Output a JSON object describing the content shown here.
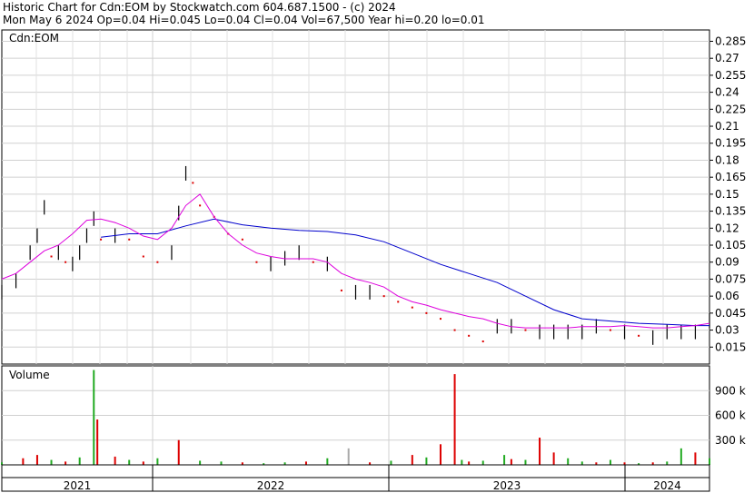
{
  "header": {
    "line1": "Historic Chart for Cdn:EOM by Stockwatch.com 604.687.1500 - (c) 2024",
    "line2": "Mon May  6 2024  Op=0.04  Hi=0.045  Lo=0.04  Cl=0.04  Vol=67,500  Year hi=0.20  lo=0.01"
  },
  "chart_data": [
    {
      "type": "line",
      "title": "Cdn:EOM",
      "xlabel": "",
      "ylabel": "",
      "x_tick_labels": [
        "2021",
        "2022",
        "2023",
        "2024"
      ],
      "y_ticks": [
        0.015,
        0.03,
        0.045,
        0.06,
        0.075,
        0.09,
        0.105,
        0.12,
        0.135,
        0.15,
        0.165,
        0.18,
        0.195,
        0.21,
        0.225,
        0.24,
        0.255,
        0.27,
        0.285
      ],
      "ylim": [
        0.0,
        0.295
      ],
      "xlim": [
        0,
        100
      ],
      "grid": true,
      "colors": {
        "up": "#000000",
        "down": "#dd0000",
        "ma_short": "#dd00dd",
        "ma_long": "#0000cc"
      },
      "series": [
        {
          "name": "",
          "kind": "price",
          "x": [
            0,
            2,
            4,
            5,
            6,
            7,
            8,
            9,
            10,
            11,
            12,
            13,
            14,
            16,
            18,
            20,
            22,
            24,
            25,
            26,
            27,
            28,
            30,
            32,
            34,
            36,
            38,
            40,
            42,
            44,
            46,
            48,
            50,
            52,
            54,
            56,
            58,
            60,
            62,
            64,
            66,
            68,
            70,
            72,
            74,
            76,
            78,
            80,
            82,
            84,
            86,
            88,
            90,
            92,
            94,
            96,
            98,
            100
          ],
          "y": [
            0.065,
            0.075,
            0.1,
            0.115,
            0.14,
            0.095,
            0.1,
            0.09,
            0.09,
            0.1,
            0.115,
            0.13,
            0.11,
            0.115,
            0.11,
            0.095,
            0.09,
            0.1,
            0.135,
            0.17,
            0.16,
            0.14,
            0.13,
            0.115,
            0.11,
            0.09,
            0.09,
            0.095,
            0.1,
            0.09,
            0.09,
            0.065,
            0.065,
            0.065,
            0.06,
            0.055,
            0.05,
            0.045,
            0.04,
            0.03,
            0.025,
            0.02,
            0.035,
            0.035,
            0.03,
            0.03,
            0.03,
            0.03,
            0.03,
            0.035,
            0.03,
            0.03,
            0.025,
            0.025,
            0.03,
            0.03,
            0.03,
            0.04
          ]
        },
        {
          "name": "",
          "kind": "ma_short",
          "x": [
            0,
            2,
            4,
            6,
            8,
            10,
            12,
            14,
            16,
            18,
            20,
            22,
            24,
            26,
            28,
            30,
            32,
            34,
            36,
            38,
            40,
            42,
            44,
            46,
            48,
            50,
            52,
            54,
            56,
            58,
            60,
            62,
            64,
            66,
            68,
            70,
            72,
            74,
            76,
            78,
            80,
            82,
            84,
            86,
            88,
            90,
            92,
            94,
            96,
            98,
            100
          ],
          "y": [
            0.075,
            0.08,
            0.09,
            0.1,
            0.105,
            0.115,
            0.127,
            0.128,
            0.125,
            0.12,
            0.113,
            0.11,
            0.12,
            0.14,
            0.15,
            0.13,
            0.115,
            0.105,
            0.098,
            0.095,
            0.093,
            0.093,
            0.093,
            0.09,
            0.08,
            0.075,
            0.072,
            0.068,
            0.06,
            0.055,
            0.052,
            0.048,
            0.045,
            0.042,
            0.04,
            0.036,
            0.033,
            0.032,
            0.032,
            0.032,
            0.032,
            0.033,
            0.033,
            0.033,
            0.034,
            0.033,
            0.032,
            0.032,
            0.033,
            0.034,
            0.036
          ]
        },
        {
          "name": "",
          "kind": "ma_long",
          "x": [
            14,
            18,
            22,
            26,
            30,
            34,
            38,
            42,
            46,
            50,
            54,
            58,
            62,
            66,
            70,
            74,
            78,
            82,
            86,
            90,
            94,
            98,
            100
          ],
          "y": [
            0.112,
            0.115,
            0.115,
            0.122,
            0.128,
            0.123,
            0.12,
            0.118,
            0.117,
            0.114,
            0.108,
            0.098,
            0.088,
            0.08,
            0.072,
            0.06,
            0.048,
            0.04,
            0.038,
            0.036,
            0.035,
            0.034,
            0.034
          ]
        }
      ]
    },
    {
      "type": "bar",
      "title": "Volume",
      "y_tick_labels": [
        "300 k",
        "600 k",
        "900 k"
      ],
      "y_ticks": [
        300000,
        600000,
        900000
      ],
      "ylim": [
        0,
        1200000
      ],
      "x": [
        0,
        3,
        5,
        7,
        9,
        11,
        13,
        13.5,
        16,
        18,
        20,
        22,
        25,
        28,
        31,
        34,
        37,
        40,
        43,
        46,
        49,
        52,
        55,
        58,
        60,
        62,
        64,
        65,
        66,
        68,
        71,
        72,
        74,
        76,
        78,
        80,
        82,
        84,
        86,
        88,
        90,
        92,
        94,
        96,
        98,
        100
      ],
      "values": [
        30000,
        80000,
        120000,
        60000,
        40000,
        90000,
        1150000,
        550000,
        100000,
        60000,
        40000,
        80000,
        300000,
        50000,
        40000,
        30000,
        20000,
        30000,
        40000,
        80000,
        200000,
        30000,
        50000,
        120000,
        90000,
        250000,
        1100000,
        60000,
        40000,
        50000,
        120000,
        70000,
        60000,
        330000,
        150000,
        80000,
        40000,
        30000,
        60000,
        30000,
        20000,
        30000,
        40000,
        200000,
        150000,
        80000
      ],
      "colors": [
        "#22aa22",
        "#dd0000",
        "#dd0000",
        "#22aa22",
        "#dd0000",
        "#22aa22",
        "#22aa22",
        "#dd0000",
        "#dd0000",
        "#22aa22",
        "#dd0000",
        "#22aa22",
        "#dd0000",
        "#22aa22",
        "#22aa22",
        "#dd0000",
        "#22aa22",
        "#22aa22",
        "#dd0000",
        "#22aa22",
        "#aaaaaa",
        "#dd0000",
        "#22aa22",
        "#dd0000",
        "#22aa22",
        "#dd0000",
        "#dd0000",
        "#22aa22",
        "#dd0000",
        "#22aa22",
        "#22aa22",
        "#dd0000",
        "#22aa22",
        "#dd0000",
        "#dd0000",
        "#22aa22",
        "#22aa22",
        "#dd0000",
        "#22aa22",
        "#dd0000",
        "#22aa22",
        "#dd0000",
        "#22aa22",
        "#22aa22",
        "#dd0000",
        "#22aa22"
      ]
    }
  ]
}
